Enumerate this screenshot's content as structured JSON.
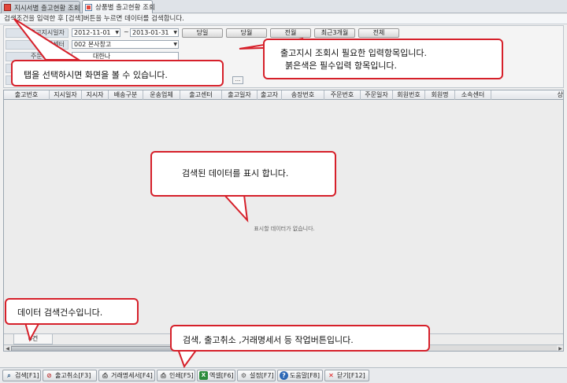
{
  "tabs": [
    {
      "label": "지시서별 출고현황 조회"
    },
    {
      "label": "상품별 출고현황 조회"
    }
  ],
  "info_line": "검색조건을 입력한 후 [검색]버튼을 누르면 데이터를 검색합니다.",
  "form": {
    "rows": [
      {
        "label": "출고지시일자"
      },
      {
        "label": "물류센터"
      },
      {
        "label": "주문자(회원)"
      },
      {
        "label": ""
      },
      {
        "label": ""
      }
    ],
    "date_from": "2012-11-01",
    "date_sep": "~",
    "date_to": "2013-01-31",
    "center_value": "002 본사창고",
    "partial_value": "대한나",
    "period_buttons": [
      "당일",
      "당월",
      "전월",
      "최근3개월",
      "전체"
    ],
    "ellipsis": "..."
  },
  "grid": {
    "columns": [
      "출고번호",
      "지시일자",
      "지시자",
      "배송구분",
      "운송업체",
      "출고센터",
      "출고일자",
      "출고자",
      "송장번호",
      "주문번호",
      "주문일자",
      "회원번호",
      "회원명",
      "소속센터",
      "상"
    ],
    "empty_message": "표시할 데이터가 없습니다.",
    "count": "0건"
  },
  "toolbar": [
    {
      "label": "검색[F1]",
      "icon": "search-icon"
    },
    {
      "label": "출고취소[F3]",
      "icon": "cancel-icon"
    },
    {
      "label": "거래명세서[F4]",
      "icon": "printer-icon"
    },
    {
      "label": "인쇄[F5]",
      "icon": "printer-icon"
    },
    {
      "label": "엑셀[F6]",
      "icon": "excel-icon"
    },
    {
      "label": "설정[F7]",
      "icon": "gear-icon"
    },
    {
      "label": "도움말[F8]",
      "icon": "help-icon"
    },
    {
      "label": "닫기[F12]",
      "icon": "close-icon"
    }
  ],
  "callouts": {
    "tab_tip": "탭을 선택하시면 화면을 볼 수 있습니다.",
    "input_tip_line1": "출고지시 조회시 필요한 입력항목입니다.",
    "input_tip_line2": "붉은색은 필수입력 항목입니다.",
    "data_tip": "검색된 데이터를 표시 합니다.",
    "count_tip": "데이터 검색건수입니다.",
    "buttons_tip": "검색, 출고취소 ,거래명세서  등 작업버튼입니다."
  },
  "colors": {
    "callout_border": "#d6202a",
    "header_bg": "#dde3ea"
  }
}
